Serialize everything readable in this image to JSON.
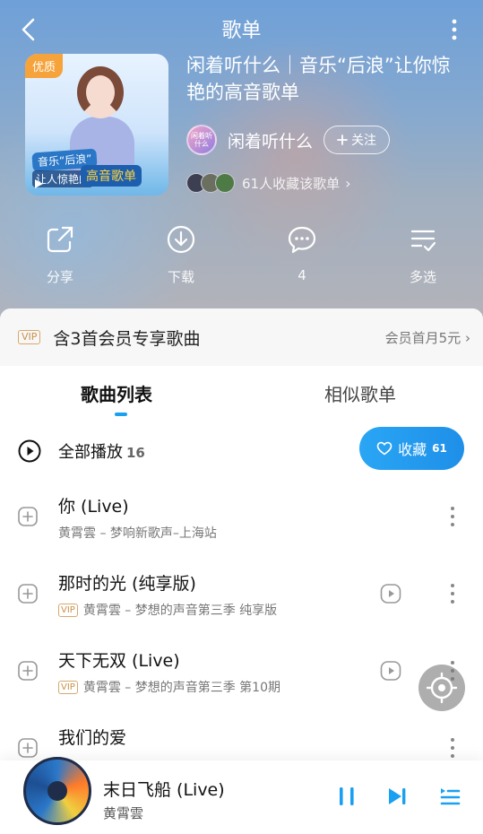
{
  "header": {
    "title": "歌单",
    "playlist_name": "闲着听什么｜音乐“后浪”让你惊艳的高音歌单",
    "cover": {
      "badge": "优质",
      "banner_line1": "音乐“后浪”",
      "banner_line2": "高音歌单",
      "banner_line3": "让人惊艳的"
    },
    "creator": {
      "avatar_text": "闲着听什么",
      "name": "闲着听什么",
      "follow_label": "关注"
    },
    "favorites_text": "61人收藏该歌单"
  },
  "actions": [
    {
      "label": "分享",
      "icon": "share-icon"
    },
    {
      "label": "下载",
      "icon": "download-icon"
    },
    {
      "label": "4",
      "icon": "comment-icon"
    },
    {
      "label": "多选",
      "icon": "multi-select-icon"
    }
  ],
  "vip_banner": {
    "tag": "VIP",
    "text": "含3首会员专享歌曲",
    "offer": "会员首月5元"
  },
  "tabs": {
    "active": "歌曲列表",
    "inactive": "相似歌单"
  },
  "play_all": {
    "label": "全部播放",
    "count": "16",
    "collect_label": "收藏",
    "collect_count": "61"
  },
  "songs": [
    {
      "title": "你 (Live)",
      "vip": "",
      "meta": "黄霄雲 – 梦响新歌声–上海站",
      "has_mv": false
    },
    {
      "title": "那时的光 (纯享版)",
      "vip": "VIP",
      "meta": "黄霄雲 – 梦想的声音第三季 纯享版",
      "has_mv": true
    },
    {
      "title": "天下无双 (Live)",
      "vip": "VIP",
      "meta": "黄霄雲 – 梦想的声音第三季 第10期",
      "has_mv": true
    },
    {
      "title": "我们的爱",
      "vip": "",
      "meta": "",
      "has_mv": false
    }
  ],
  "player": {
    "title": "末日飞船 (Live)",
    "artist": "黄霄雲"
  },
  "colors": {
    "accent": "#1aa0f0",
    "vip": "#c9914b"
  }
}
